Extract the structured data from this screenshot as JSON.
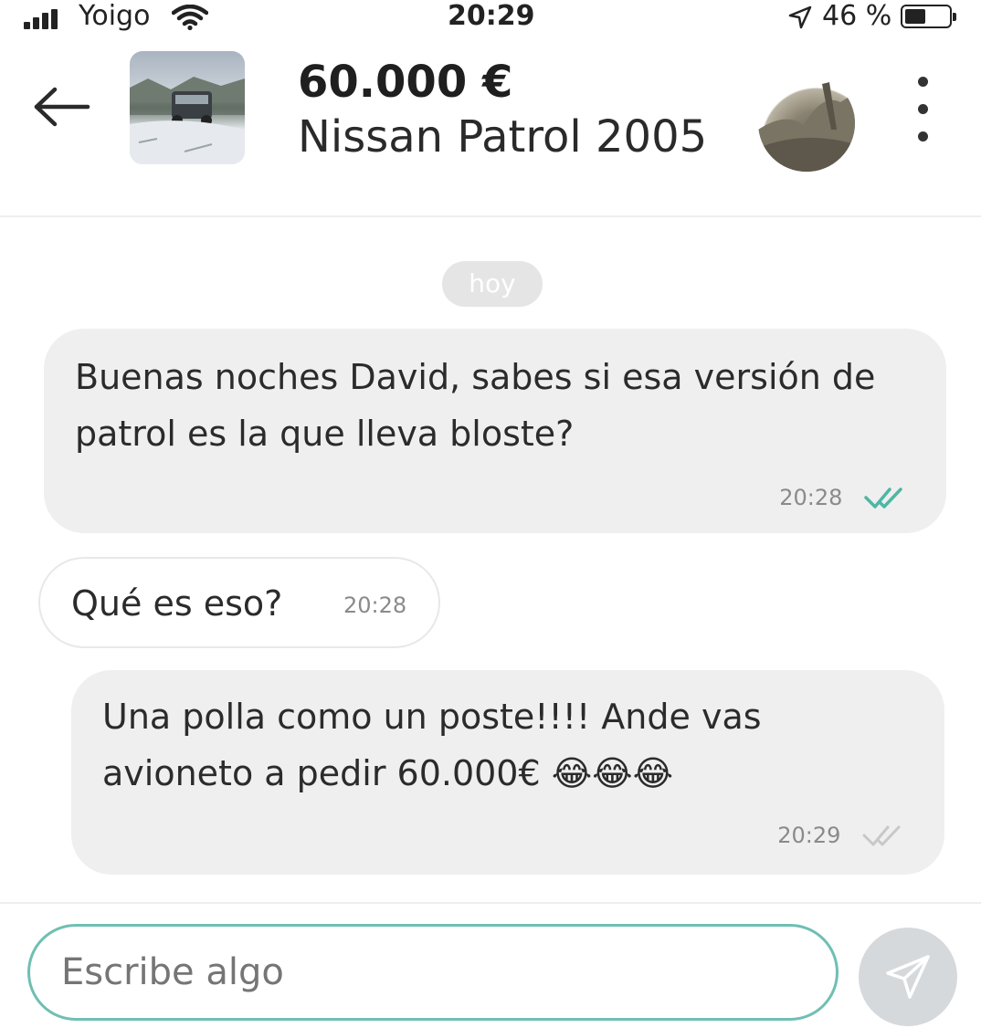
{
  "status_bar": {
    "carrier": "Yoigo",
    "time": "20:29",
    "battery": "46 %",
    "icons": [
      "signal-icon",
      "wifi-icon",
      "location-arrow-icon",
      "battery-icon"
    ]
  },
  "header": {
    "price": "60.000 €",
    "title": "Nissan Patrol 2005",
    "icons": [
      "back-arrow-icon",
      "more-vertical-icon"
    ]
  },
  "chat": {
    "day_label": "hoy",
    "messages": [
      {
        "direction": "outgoing",
        "text": "Buenas noches David, sabes si esa versión de patrol es la que lleva bloste?",
        "time": "20:28",
        "status": "read",
        "tick_color": "#4fb6a5"
      },
      {
        "direction": "incoming",
        "text": "Qué es eso?",
        "time": "20:28"
      },
      {
        "direction": "outgoing",
        "text": "Una polla como un poste!!!! Ande vas avioneto a pedir 60.000€",
        "emoji": "😂😂😂",
        "time": "20:29",
        "status": "delivered",
        "tick_color": "#c8c8c8"
      }
    ]
  },
  "composer": {
    "placeholder": "Escribe algo",
    "accent": "#6fbfb3",
    "send_icon": "send-icon"
  }
}
